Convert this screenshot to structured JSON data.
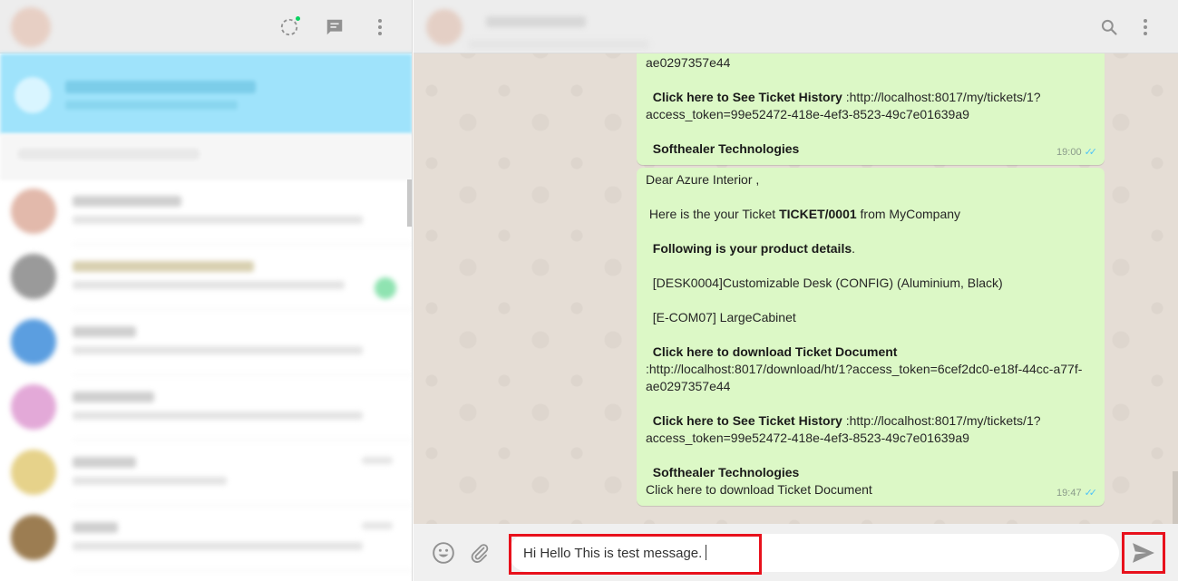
{
  "left_header": {
    "icons": [
      "status-icon",
      "new-chat-icon",
      "menu-icon"
    ],
    "status_color": "#09d261"
  },
  "messages": [
    {
      "lines": [
        {
          "text": "ae0297357e44"
        },
        {
          "gap": true
        },
        {
          "bold": "Click here to See Ticket History",
          "text": " :http://localhost:8017/my/tickets/1?"
        },
        {
          "text": "access_token=99e52472-418e-4ef3-8523-49c7e01639a9"
        },
        {
          "gap": true
        },
        {
          "bold": "Softhealer Technologies",
          "text": ""
        }
      ],
      "time": "19:00"
    },
    {
      "lines": [
        {
          "text": "Dear Azure Interior ,"
        },
        {
          "gap": true
        },
        {
          "text": " Here is the your Ticket ",
          "bold_mid": "TICKET/0001",
          "after": " from MyCompany"
        },
        {
          "gap": true
        },
        {
          "bold": "Following is your product details",
          "text": "."
        },
        {
          "gap": true
        },
        {
          "text": "  [DESK0004]Customizable Desk (CONFIG) (Aluminium, Black)"
        },
        {
          "gap": true
        },
        {
          "text": "  [E-COM07] LargeCabinet"
        },
        {
          "gap": true
        },
        {
          "bold": "Click here to download Ticket Document",
          "text": ""
        },
        {
          "text": ":http://localhost:8017/download/ht/1?access_token=6cef2dc0-e18f-44cc-a77f-"
        },
        {
          "text": "ae0297357e44"
        },
        {
          "gap": true
        },
        {
          "bold": "Click here to See Ticket History",
          "text": " :http://localhost:8017/my/tickets/1?"
        },
        {
          "text": "access_token=99e52472-418e-4ef3-8523-49c7e01639a9"
        },
        {
          "gap": true
        },
        {
          "bold": "Softhealer Technologies",
          "text": ""
        },
        {
          "text": "Click here to download Ticket Document"
        }
      ],
      "time": "19:47"
    }
  ],
  "composer": {
    "value": "Hi Hello This is test message.",
    "icons": [
      "emoji-icon",
      "attach-icon",
      "send-icon"
    ],
    "highlight_color": "#e8111c"
  },
  "colors": {
    "outgoing_bubble": "#dcf8c6",
    "chat_background": "#e5ddd5",
    "header_background": "#ededed",
    "read_ticks": "#4fc3f7"
  }
}
